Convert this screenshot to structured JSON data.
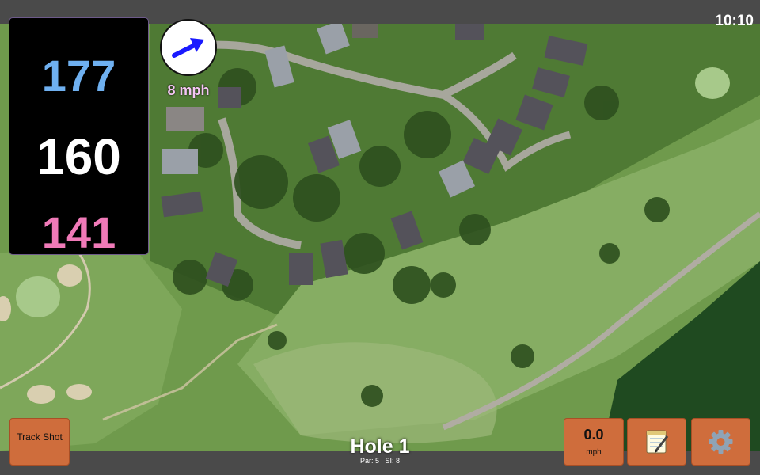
{
  "status": {
    "time": "10:10"
  },
  "distances": {
    "back": "177",
    "middle": "160",
    "front": "141"
  },
  "wind": {
    "speed_label": "8 mph",
    "icon": "wind-direction-arrow-icon"
  },
  "buttons": {
    "track_shot": "Track Shot",
    "speed_value": "0.0",
    "speed_unit": "mph",
    "notes_icon": "notepad-icon",
    "settings_icon": "gear-icon"
  },
  "hole": {
    "title": "Hole 1",
    "par_label": "Par: 5",
    "si_label": "SI: 8"
  },
  "colors": {
    "back_distance": "#6fb0f0",
    "middle_distance": "#ffffff",
    "front_distance": "#f07ab8",
    "wind_label": "#f5c6f5",
    "button_bg": "#cf6d3c"
  }
}
